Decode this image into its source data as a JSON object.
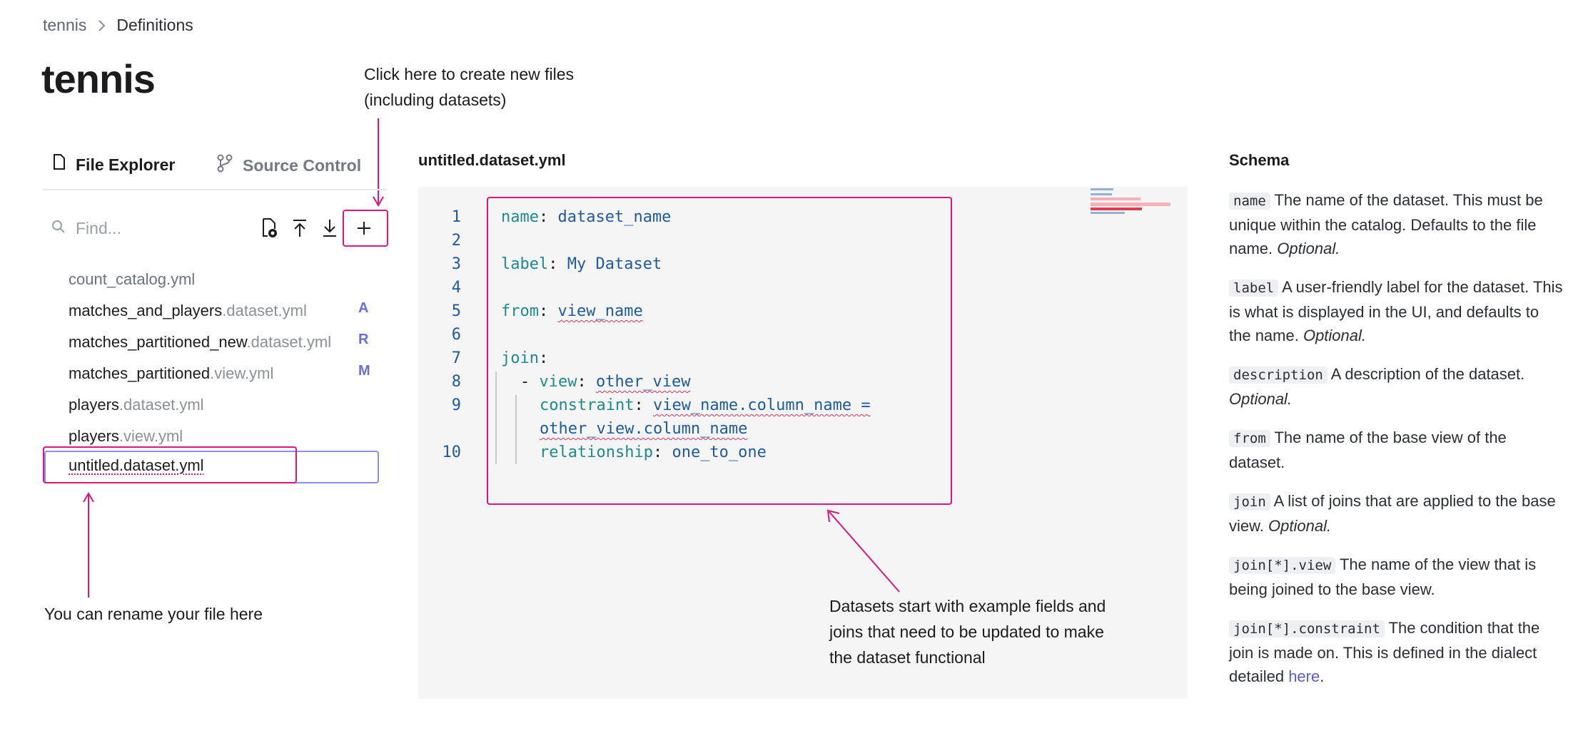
{
  "breadcrumb": {
    "root": "tennis",
    "current": "Definitions"
  },
  "page_title": "tennis",
  "annotations": {
    "create_files": [
      "Click here to create new files",
      "(including datasets)"
    ],
    "rename": "You can rename your file here",
    "datasets": [
      "Datasets start with example fields and",
      "joins that need to be updated to make",
      "the dataset functional"
    ]
  },
  "colors": {
    "annotation": "#e0157a",
    "accent": "#6b6be0",
    "code_key": "#1f8a8a",
    "code_value": "#1e5aa0"
  },
  "tabs": [
    {
      "label": "File Explorer",
      "icon": "file-icon",
      "active": true
    },
    {
      "label": "Source Control",
      "icon": "git-branch-icon",
      "active": false
    }
  ],
  "search": {
    "placeholder": "Find..."
  },
  "toolbar": {
    "icons": [
      "new-file-gear-icon",
      "upload-icon",
      "download-icon",
      "plus-icon"
    ]
  },
  "files": [
    {
      "name": "count_catalog.yml",
      "ext": "",
      "status": ""
    },
    {
      "name": "matches_and_players",
      "ext": ".dataset.yml",
      "status": "A"
    },
    {
      "name": "matches_partitioned_new",
      "ext": ".dataset.yml",
      "status": "R"
    },
    {
      "name": "matches_partitioned",
      "ext": ".view.yml",
      "status": "M"
    },
    {
      "name": "players",
      "ext": ".dataset.yml",
      "status": ""
    },
    {
      "name": "players",
      "ext": ".view.yml",
      "status": ""
    }
  ],
  "rename_value": "untitled.dataset.yml",
  "editor": {
    "title": "untitled.dataset.yml",
    "line_numbers": [
      "1",
      "2",
      "3",
      "4",
      "5",
      "6",
      "7",
      "8",
      "9",
      "10"
    ],
    "code": {
      "l1_key": "name",
      "l1_val": "dataset_name",
      "l3_key": "label",
      "l3_val": "My Dataset",
      "l5_key": "from",
      "l5_val": "view_name",
      "l7_key": "join",
      "l8_dash": "- ",
      "l8_key": "view",
      "l8_val": "other_view",
      "l9_key": "constraint",
      "l9_val_a": "view_name.column_name =",
      "l9_val_b": "other_view.column_name",
      "l10_key": "relationship",
      "l10_val": "one_to_one",
      "colon": ": "
    }
  },
  "schema": {
    "title": "Schema",
    "items": [
      {
        "code": "name",
        "text": " The name of the dataset. This must be unique within the catalog. Defaults to the file name. ",
        "italic": "Optional."
      },
      {
        "code": "label",
        "text": " A user-friendly label for the dataset. This is what is displayed in the UI, and defaults to the name. ",
        "italic": "Optional."
      },
      {
        "code": "description",
        "text": " A description of the dataset. ",
        "italic": "Optional."
      },
      {
        "code": "from",
        "text": " The name of the base view of the dataset.",
        "italic": ""
      },
      {
        "code": "join",
        "text": " A list of joins that are applied to the base view. ",
        "italic": "Optional."
      },
      {
        "code": "join[*].view",
        "text": " The name of the view that is being joined to the base view.",
        "italic": ""
      },
      {
        "code": "join[*].constraint",
        "text": " The condition that the join is made on. This is defined in the dialect detailed ",
        "italic": "",
        "link": "here",
        "after": "."
      }
    ]
  }
}
